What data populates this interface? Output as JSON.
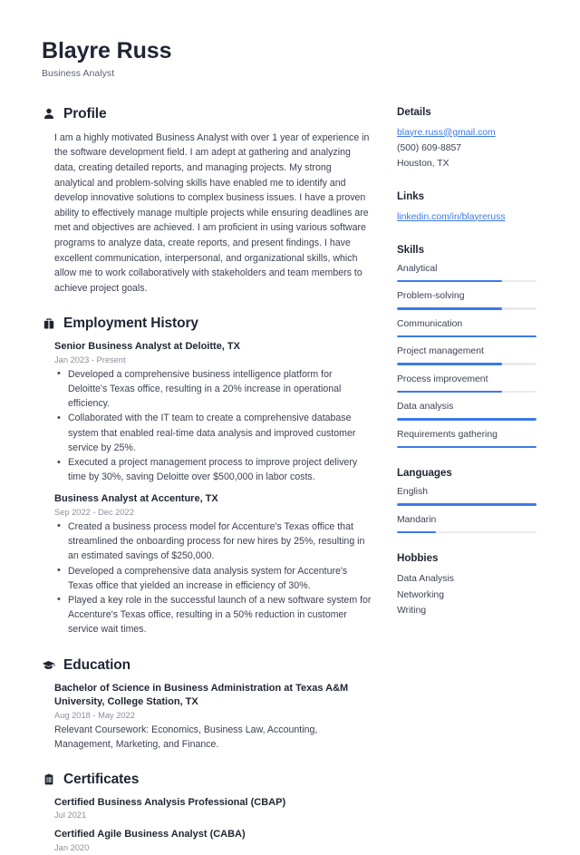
{
  "colors": {
    "accent": "#3b79e8",
    "heading": "#1f2533",
    "text": "#3d4254",
    "muted": "#8a8f9e",
    "track": "#e9eaee",
    "background": "#ffffff"
  },
  "header": {
    "name": "Blayre Russ",
    "job_title": "Business Analyst"
  },
  "sections": {
    "profile": {
      "title": "Profile",
      "icon": "person-icon",
      "text": "I am a highly motivated Business Analyst with over 1 year of experience in the software development field. I am adept at gathering and analyzing data, creating detailed reports, and managing projects. My strong analytical and problem-solving skills have enabled me to identify and develop innovative solutions to complex business issues. I have a proven ability to effectively manage multiple projects while ensuring deadlines are met and objectives are achieved. I am proficient in using various software programs to analyze data, create reports, and present findings. I have excellent communication, interpersonal, and organizational skills, which allow me to work collaboratively with stakeholders and team members to achieve project goals."
    },
    "employment": {
      "title": "Employment History",
      "icon": "briefcase-icon",
      "entries": [
        {
          "title": "Senior Business Analyst at Deloitte, TX",
          "date": "Jan 2023 - Present",
          "bullets": [
            "Developed a comprehensive business intelligence platform for Deloitte's Texas office, resulting in a 20% increase in operational efficiency.",
            "Collaborated with the IT team to create a comprehensive database system that enabled real-time data analysis and improved customer service by 25%.",
            "Executed a project management process to improve project delivery time by 30%, saving Deloitte over $500,000 in labor costs."
          ]
        },
        {
          "title": "Business Analyst at Accenture, TX",
          "date": "Sep 2022 - Dec 2022",
          "bullets": [
            "Created a business process model for Accenture's Texas office that streamlined the onboarding process for new hires by 25%, resulting in an estimated savings of $250,000.",
            "Developed a comprehensive data analysis system for Accenture's Texas office that yielded an increase in efficiency of 30%.",
            "Played a key role in the successful launch of a new software system for Accenture's Texas office, resulting in a 50% reduction in customer service wait times."
          ]
        }
      ]
    },
    "education": {
      "title": "Education",
      "icon": "graduation-cap-icon",
      "entries": [
        {
          "title": "Bachelor of Science in Business Administration at Texas A&M University, College Station, TX",
          "date": "Aug 2018 - May 2022",
          "description": "Relevant Coursework: Economics, Business Law, Accounting, Management, Marketing, and Finance."
        }
      ]
    },
    "certificates": {
      "title": "Certificates",
      "icon": "clipboard-icon",
      "entries": [
        {
          "title": "Certified Business Analysis Professional (CBAP)",
          "date": "Jul 2021"
        },
        {
          "title": "Certified Agile Business Analyst (CABA)",
          "date": "Jan 2020"
        }
      ]
    }
  },
  "sidebar": {
    "details": {
      "title": "Details",
      "email": "blayre.russ@gmail.com",
      "phone": "(500) 609-8857",
      "location": "Houston, TX"
    },
    "links": {
      "title": "Links",
      "items": [
        {
          "label": "linkedin.com/in/blayreruss"
        }
      ]
    },
    "skills": {
      "title": "Skills",
      "items": [
        {
          "label": "Analytical",
          "level": 75
        },
        {
          "label": "Problem-solving",
          "level": 75
        },
        {
          "label": "Communication",
          "level": 100
        },
        {
          "label": "Project management",
          "level": 75
        },
        {
          "label": "Process improvement",
          "level": 75
        },
        {
          "label": "Data analysis",
          "level": 100
        },
        {
          "label": "Requirements gathering",
          "level": 100
        }
      ]
    },
    "languages": {
      "title": "Languages",
      "items": [
        {
          "label": "English",
          "level": 100
        },
        {
          "label": "Mandarin",
          "level": 28
        }
      ]
    },
    "hobbies": {
      "title": "Hobbies",
      "items": [
        {
          "label": "Data Analysis"
        },
        {
          "label": "Networking"
        },
        {
          "label": "Writing"
        }
      ]
    }
  }
}
